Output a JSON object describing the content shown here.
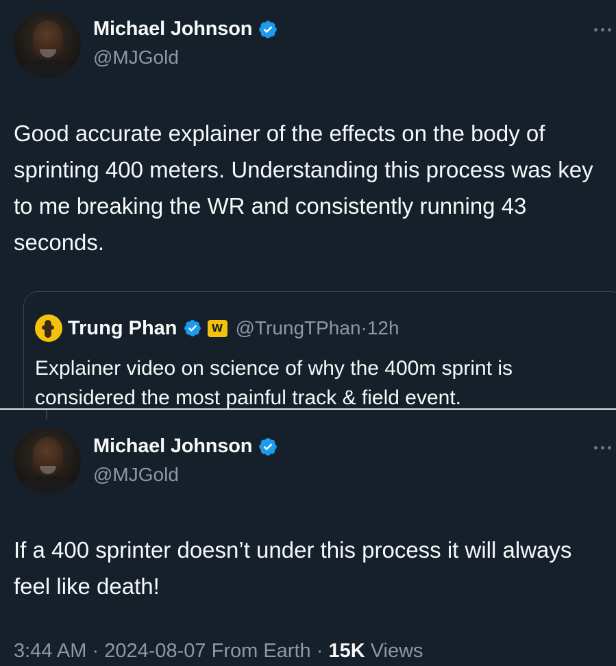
{
  "tweet1": {
    "author_name": "Michael Johnson",
    "author_handle": "@MJGold",
    "text": "Good accurate explainer of the effects on the body of sprinting 400 meters. Understanding this process was key to me breaking the WR and consistently running 43 seconds.",
    "verified_icon": "verified-badge-icon",
    "more_icon": "more-options-icon"
  },
  "quoted_tweet": {
    "author_name": "Trung Phan",
    "author_handle": "@TrungTPhan",
    "separator": "·",
    "time": "12h",
    "badge_label": "W",
    "text": "Explainer video on science of why the 400m sprint is considered the most painful track & field event."
  },
  "tweet2": {
    "author_name": "Michael Johnson",
    "author_handle": "@MJGold",
    "text": "If a 400 sprinter doesn’t under this process it will always feel like death!",
    "time": "3:44 AM",
    "separator": "·",
    "date": "2024-08-07",
    "source": "From Earth",
    "separator2": "·",
    "views_count": "15K",
    "views_label": "Views"
  },
  "colors": {
    "background": "#15202b",
    "text_primary": "#f7f9f9",
    "text_secondary": "#8b98a5",
    "verified_blue": "#1d9bf0",
    "gold_badge": "#f4c20d",
    "border": "#38444d"
  }
}
